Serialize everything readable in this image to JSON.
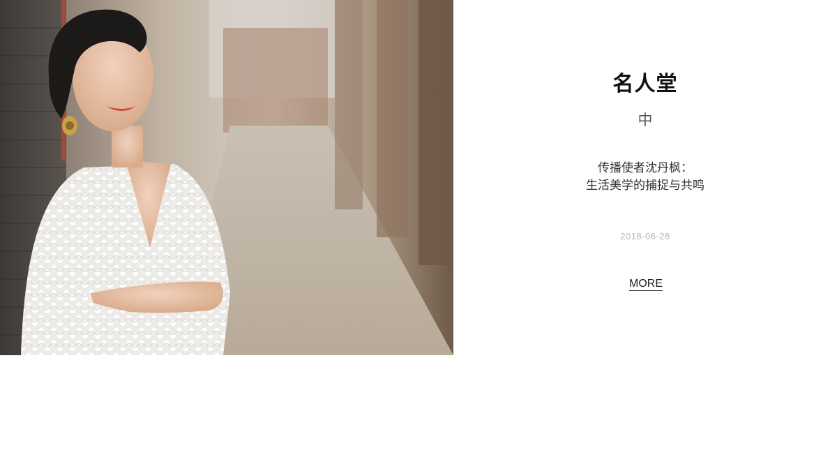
{
  "section": {
    "title": "名人堂",
    "subtitle": "中"
  },
  "article": {
    "headline_line1": "传播使者沈丹枫：",
    "headline_line2": "生活美学的捕捉与共鸣",
    "date": "2018-06-28",
    "more_label": "MORE"
  },
  "photo": {
    "subject": "woman-in-white-lace-dress-leaning-on-brick-wall"
  },
  "colors": {
    "background": "#ffffff",
    "title": "#111111",
    "date": "#b5b5b5",
    "link": "#222222"
  }
}
